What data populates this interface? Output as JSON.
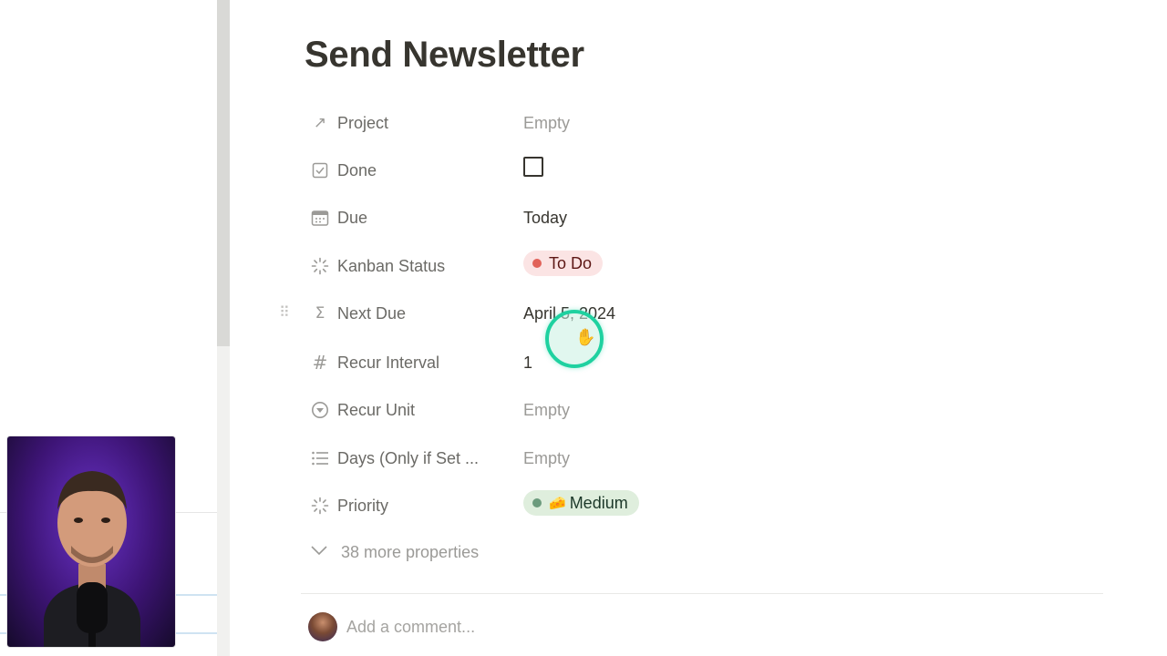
{
  "page": {
    "title": "Send Newsletter"
  },
  "properties": [
    {
      "icon": "arrow-up-right-icon",
      "label": "Project",
      "value": "Empty",
      "type": "relation"
    },
    {
      "icon": "checkbox-icon",
      "label": "Done",
      "value": "",
      "type": "checkbox",
      "checked": false
    },
    {
      "icon": "calendar-icon",
      "label": "Due",
      "value": "Today",
      "type": "date"
    },
    {
      "icon": "status-icon",
      "label": "Kanban Status",
      "value": "To Do",
      "type": "status"
    },
    {
      "icon": "sigma-icon",
      "label": "Next Due",
      "value": "April 5, 2024",
      "type": "formula"
    },
    {
      "icon": "hash-icon",
      "label": "Recur Interval",
      "value": "1",
      "type": "number"
    },
    {
      "icon": "select-icon",
      "label": "Recur Unit",
      "value": "Empty",
      "type": "select"
    },
    {
      "icon": "list-icon",
      "label": "Days (Only if Set ...",
      "value": "Empty",
      "type": "multi-select"
    },
    {
      "icon": "status-icon",
      "label": "Priority",
      "value": "Medium",
      "emoji": "🧀",
      "type": "status"
    }
  ],
  "more_properties": {
    "label": "38 more properties"
  },
  "comment": {
    "placeholder": "Add a comment..."
  },
  "colors": {
    "todo_pill_bg": "#fbe4e4",
    "todo_dot": "#e16259",
    "medium_pill_bg": "#dfeedd",
    "medium_dot": "#6c9b7d",
    "cursor_ring": "#1fd1a0"
  }
}
